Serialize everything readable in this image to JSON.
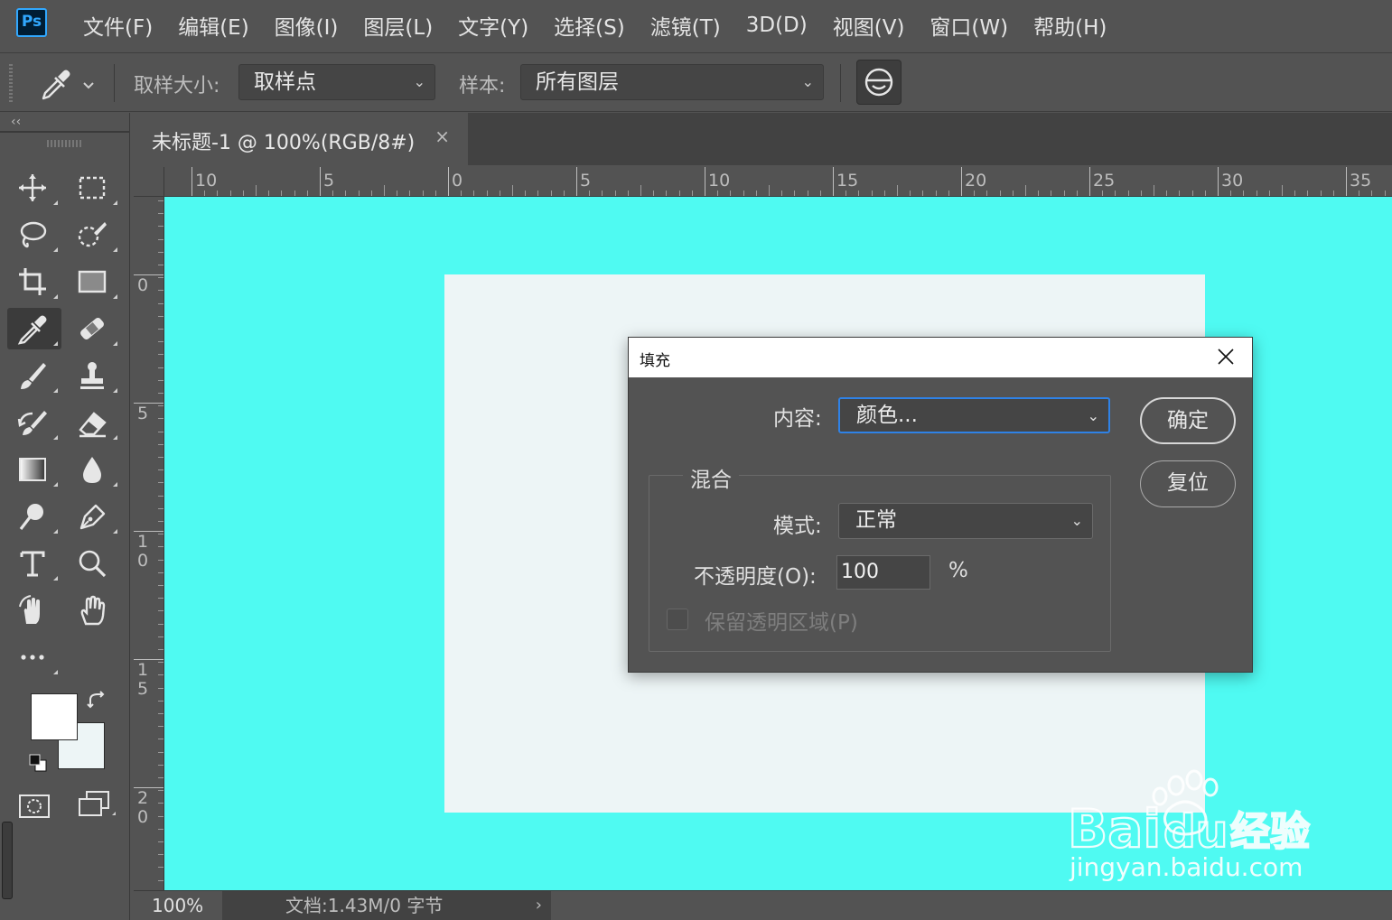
{
  "app": {
    "logo_text": "Ps"
  },
  "menu": [
    "文件(F)",
    "编辑(E)",
    "图像(I)",
    "图层(L)",
    "文字(Y)",
    "选择(S)",
    "滤镜(T)",
    "3D(D)",
    "视图(V)",
    "窗口(W)",
    "帮助(H)"
  ],
  "options": {
    "sample_size_label": "取样大小:",
    "sample_size_value": "取样点",
    "sample_label": "样本:",
    "sample_value": "所有图层"
  },
  "toolbar": {
    "collapse_glyph": "‹‹",
    "foreground_color": "#ffffff",
    "background_color": "#edf5f6"
  },
  "document": {
    "tab_title": "未标题-1 @ 100%(RGB/8#)",
    "tab_close": "×",
    "canvas_color": "#4ffaf2",
    "page_color": "#edf5f6"
  },
  "ruler": {
    "horizontal": [
      "10",
      "5",
      "0",
      "5",
      "10",
      "15",
      "20",
      "25",
      "30",
      "35"
    ],
    "vertical": [
      "0",
      "5",
      "1\n0",
      "1\n5",
      "2\n0"
    ]
  },
  "status": {
    "zoom": "100%",
    "doc_info": "文档:1.43M/0 字节",
    "arrow": "›"
  },
  "dialog": {
    "title": "填充",
    "content_label": "内容:",
    "content_value": "颜色...",
    "blend_legend": "混合",
    "mode_label": "模式:",
    "mode_value": "正常",
    "opacity_label": "不透明度(O):",
    "opacity_value": "100",
    "opacity_unit": "%",
    "preserve_label": "保留透明区域(P)",
    "ok_button": "确定",
    "reset_button": "复位"
  },
  "watermark": {
    "url_text": "jingyan.baidu.com"
  }
}
